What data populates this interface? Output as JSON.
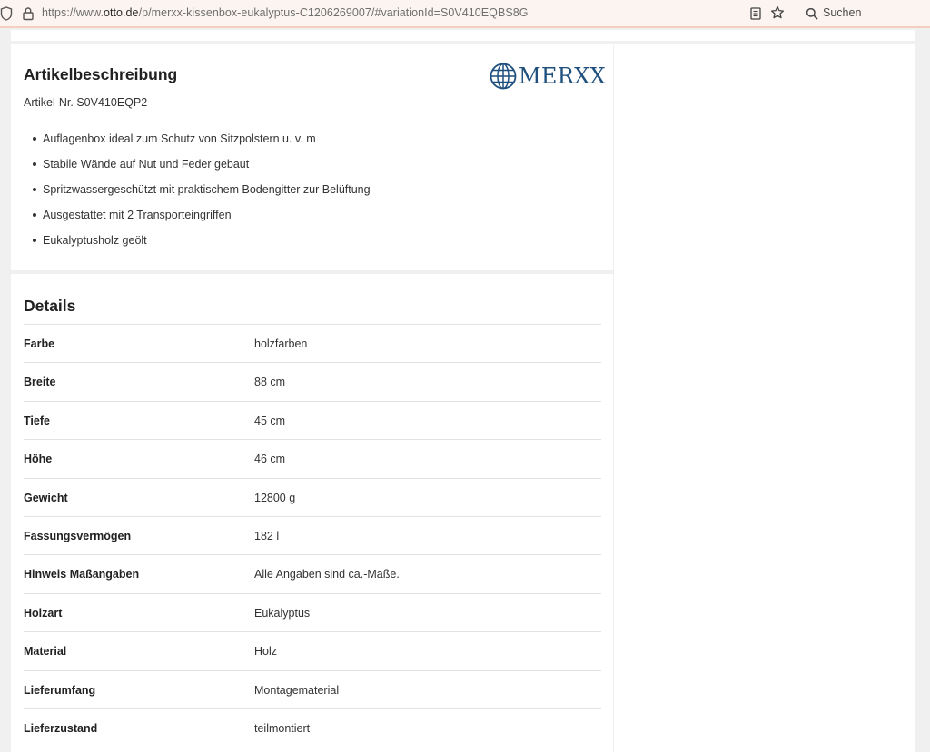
{
  "browser": {
    "url_prefix": "https://www.",
    "url_host": "otto.de",
    "url_path": "/p/merxx-kissenbox-eukalyptus-C1206269007/#variationId=S0V410EQBS8G",
    "search_placeholder": "Suchen",
    "icons": [
      "shield-icon",
      "lock-icon",
      "reader-view-icon",
      "bookmark-star-icon",
      "search-icon"
    ]
  },
  "description": {
    "heading": "Artikelbeschreibung",
    "article_number": "Artikel-Nr. S0V410EQP2",
    "brand": "MERXX",
    "bullets": [
      "Auflagenbox ideal zum Schutz von Sitzpolstern u. v. m",
      "Stabile Wände auf Nut und Feder gebaut",
      "Spritzwassergeschützt mit praktischem Bodengitter zur Belüftung",
      "Ausgestattet mit 2 Transporteingriffen",
      "Eukalyptusholz geölt"
    ]
  },
  "details": {
    "heading": "Details",
    "rows": [
      {
        "label": "Farbe",
        "value": "holzfarben"
      },
      {
        "label": "Breite",
        "value": "88 cm"
      },
      {
        "label": "Tiefe",
        "value": "45 cm"
      },
      {
        "label": "Höhe",
        "value": "46 cm"
      },
      {
        "label": "Gewicht",
        "value": "12800 g"
      },
      {
        "label": "Fassungsvermögen",
        "value": "182 l"
      },
      {
        "label": "Hinweis Maßangaben",
        "value": "Alle Angaben sind ca.-Maße."
      },
      {
        "label": "Holzart",
        "value": "Eukalyptus"
      },
      {
        "label": "Material",
        "value": "Holz"
      },
      {
        "label": "Lieferumfang",
        "value": "Montagematerial"
      },
      {
        "label": "Lieferzustand",
        "value": "teilmontiert"
      }
    ]
  },
  "colors": {
    "brand_blue": "#1f4f7c",
    "toolbar_bg": "#fbf4f1",
    "toolbar_border": "#f2cfc0"
  }
}
